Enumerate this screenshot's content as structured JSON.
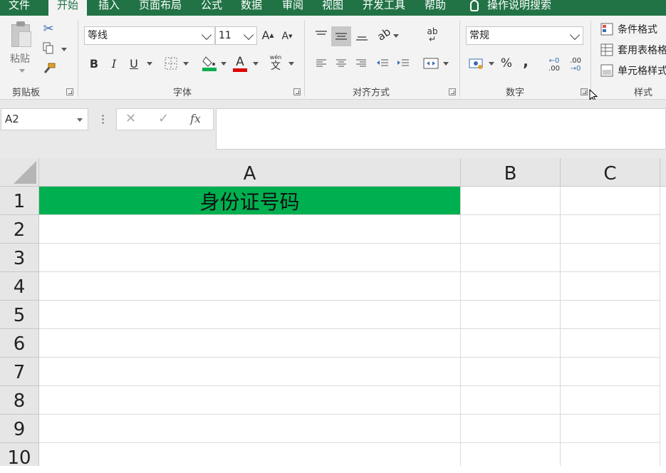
{
  "tabs": [
    {
      "label": "文件",
      "active": false
    },
    {
      "label": "开始",
      "active": true
    },
    {
      "label": "插入",
      "active": false
    },
    {
      "label": "页面布局",
      "active": false
    },
    {
      "label": "公式",
      "active": false
    },
    {
      "label": "数据",
      "active": false
    },
    {
      "label": "审阅",
      "active": false
    },
    {
      "label": "视图",
      "active": false
    },
    {
      "label": "开发工具",
      "active": false
    },
    {
      "label": "帮助",
      "active": false
    }
  ],
  "search_label": "操作说明搜索",
  "clipboard": {
    "paste_label": "粘贴",
    "group_label": "剪贴板"
  },
  "font": {
    "name": "等线",
    "size": "11",
    "group_label": "字体",
    "bold": "B",
    "italic": "I",
    "underline": "U",
    "font_color_glyph": "A",
    "pinyin_top": "wén",
    "pinyin_char": "文",
    "fill_color": "#00b050",
    "font_color": "#e00000"
  },
  "alignment": {
    "group_label": "对齐方式",
    "wrap_glyph": "ab"
  },
  "number": {
    "format": "常规",
    "group_label": "数字",
    "percent": "%",
    "comma": ",",
    "inc_decimal": ".00",
    "dec_decimal": ".00"
  },
  "styles": {
    "items": [
      "条件格式",
      "套用表格格",
      "单元格样式"
    ],
    "group_label": "样式"
  },
  "formula_bar": {
    "name_box": "A2",
    "cancel": "✕",
    "enter": "✓",
    "fx": "fx",
    "formula": ""
  },
  "columns": [
    "A",
    "B",
    "C"
  ],
  "rows": [
    "1",
    "2",
    "3",
    "4",
    "5",
    "6",
    "7",
    "8",
    "9",
    "10"
  ],
  "cells": {
    "A1": "身份证号码"
  },
  "colors": {
    "accent": "#217346",
    "header_fill": "#00b050"
  }
}
